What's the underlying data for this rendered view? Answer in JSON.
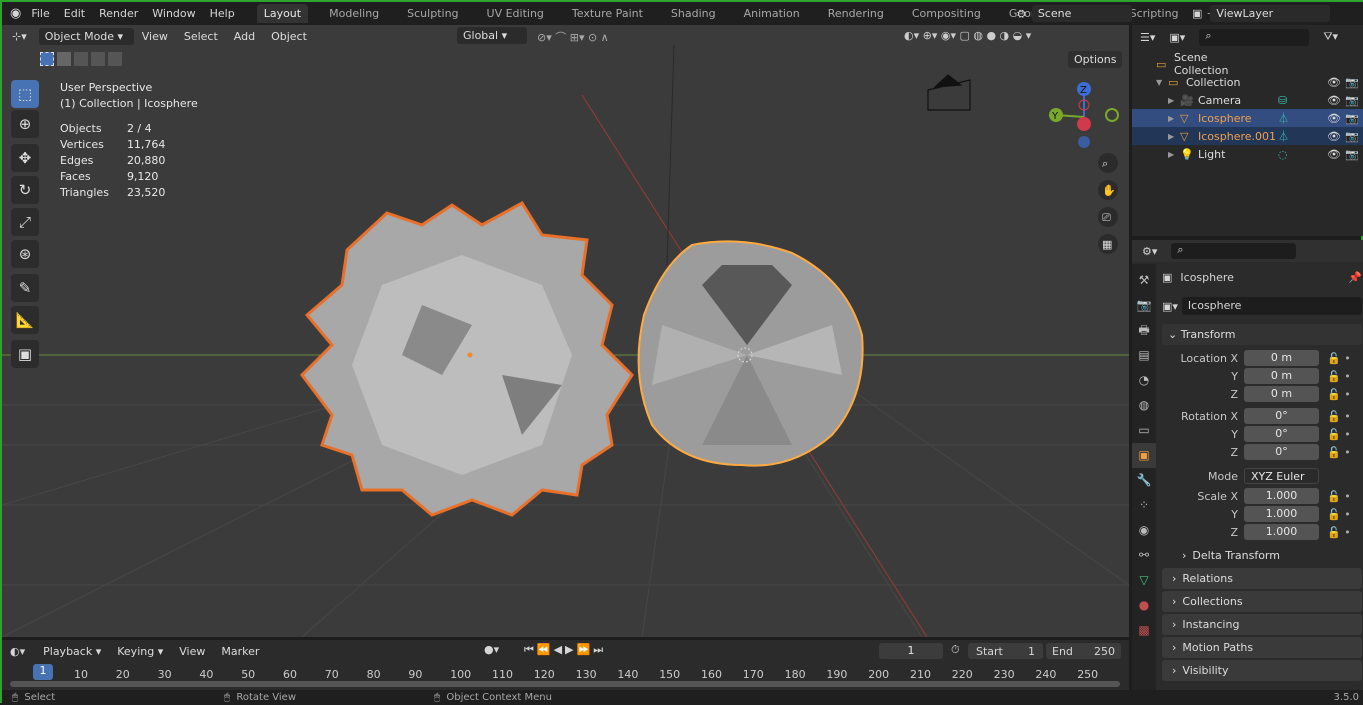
{
  "topbar": {
    "menus": [
      "File",
      "Edit",
      "Render",
      "Window",
      "Help"
    ],
    "workspaces": [
      "Layout",
      "Modeling",
      "Sculpting",
      "UV Editing",
      "Texture Paint",
      "Shading",
      "Animation",
      "Rendering",
      "Compositing",
      "Geometry Nodes",
      "Scripting"
    ],
    "active_workspace": "Layout",
    "add_tab": "+",
    "scene": "Scene",
    "view_layer": "ViewLayer"
  },
  "viewport_header": {
    "mode": "Object Mode",
    "menus": [
      "View",
      "Select",
      "Add",
      "Object"
    ],
    "orientation": "Global",
    "options": "Options"
  },
  "viewport": {
    "view_name": "User Perspective",
    "collection_info": "(1) Collection | Icosphere",
    "stats": [
      {
        "label": "Objects",
        "value": "2 / 4"
      },
      {
        "label": "Vertices",
        "value": "11,764"
      },
      {
        "label": "Edges",
        "value": "20,880"
      },
      {
        "label": "Faces",
        "value": "9,120"
      },
      {
        "label": "Triangles",
        "value": "23,520"
      }
    ],
    "gizmo": {
      "x": "X",
      "y": "Y",
      "z": "Z"
    },
    "tools": [
      "select-box-icon",
      "cursor-icon",
      "move-icon",
      "rotate-icon",
      "scale-icon",
      "transform-icon",
      "annotate-icon",
      "measure-icon",
      "add-cube-icon"
    ]
  },
  "outliner": {
    "search_placeholder": "",
    "items": [
      {
        "label": "Scene Collection",
        "level": 0
      },
      {
        "label": "Collection",
        "level": 1
      },
      {
        "label": "Camera",
        "level": 2
      },
      {
        "label": "Icosphere",
        "level": 2,
        "selected": "active"
      },
      {
        "label": "Icosphere.001",
        "level": 2,
        "selected": "yes"
      },
      {
        "label": "Light",
        "level": 2
      }
    ]
  },
  "properties": {
    "object_name": "Icosphere",
    "data_name": "Icosphere",
    "transform_label": "Transform",
    "location": {
      "label": "Location X",
      "x": "0 m",
      "y": "0 m",
      "z": "0 m"
    },
    "rotation": {
      "label": "Rotation X",
      "x": "0°",
      "y": "0°",
      "z": "0°"
    },
    "mode_label": "Mode",
    "mode": "XYZ Euler",
    "scale": {
      "label": "Scale X",
      "x": "1.000",
      "y": "1.000",
      "z": "1.000"
    },
    "axis_y": "Y",
    "axis_z": "Z",
    "sections": [
      "Delta Transform",
      "Relations",
      "Collections",
      "Instancing",
      "Motion Paths",
      "Visibility"
    ]
  },
  "timeline": {
    "menus": [
      "Playback",
      "Keying",
      "View",
      "Marker"
    ],
    "current_frame": "1",
    "start_label": "Start",
    "start": "1",
    "end_label": "End",
    "end": "250",
    "ticks": [
      "10",
      "20",
      "30",
      "40",
      "50",
      "60",
      "70",
      "80",
      "90",
      "100",
      "110",
      "120",
      "130",
      "140",
      "150",
      "160",
      "170",
      "180",
      "190",
      "200",
      "210",
      "220",
      "230",
      "240",
      "250"
    ]
  },
  "statusbar": {
    "items": [
      "Select",
      "Rotate View",
      "Object Context Menu"
    ],
    "version": "3.5.0"
  },
  "colors": {
    "accent": "#4772b3",
    "selection_orange": "#f08a30",
    "active_outline": "#ffaa40"
  }
}
